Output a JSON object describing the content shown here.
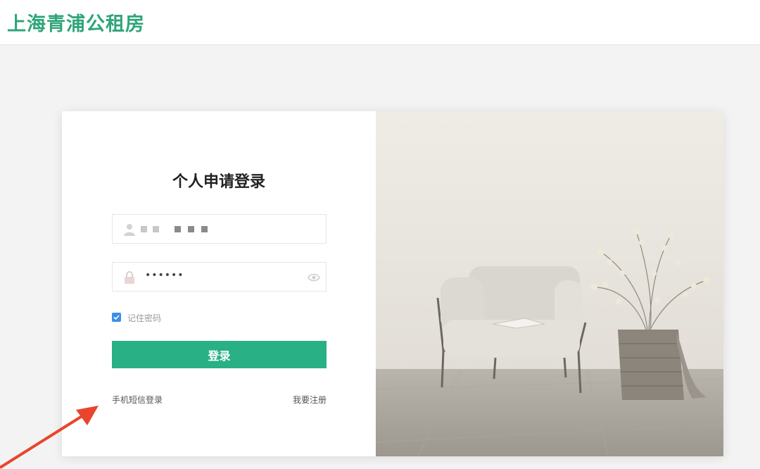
{
  "header": {
    "site_title": "上海青浦公租房"
  },
  "login": {
    "title": "个人申请登录",
    "username_value": "",
    "password_value": "••••••",
    "remember_label": "记住密码",
    "remember_checked": true,
    "submit_label": "登录",
    "sms_login_link": "手机短信登录",
    "register_link": "我要注册"
  },
  "colors": {
    "brand": "#29b085",
    "checkbox": "#3a8ee6",
    "annotation_arrow": "#e8452c"
  },
  "icons": [
    "user-icon",
    "lock-icon",
    "eye-icon",
    "check-icon"
  ],
  "hero_image": {
    "subject": "armchair-with-plant-basket"
  }
}
